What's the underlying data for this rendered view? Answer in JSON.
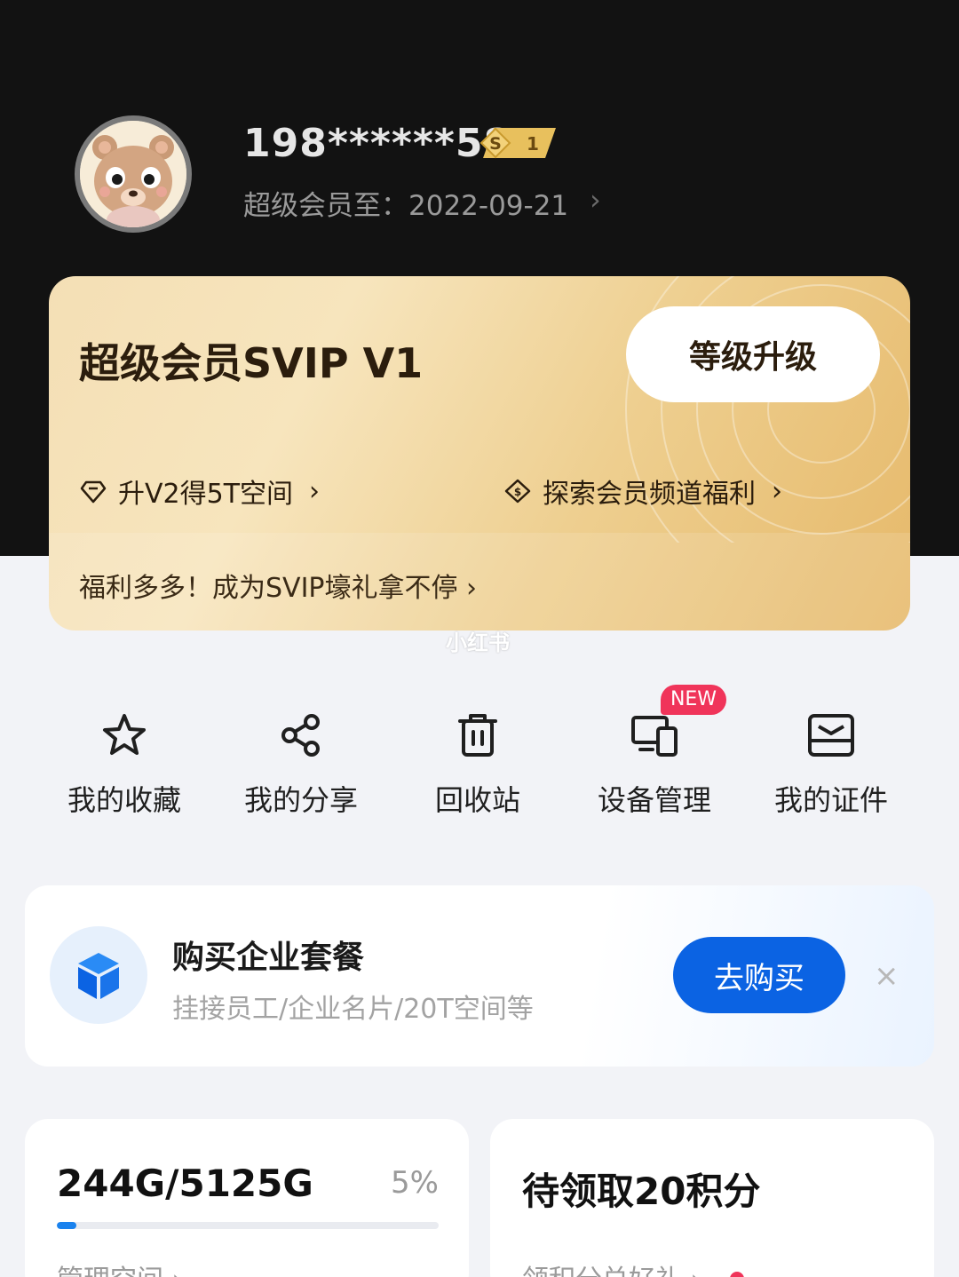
{
  "profile": {
    "username": "198******58",
    "level_badge": "1",
    "expiry": "超级会员至：2022-09-21",
    "expiry_arrow": "›"
  },
  "svip_card": {
    "title": "超级会员SVIP V1",
    "upgrade_label": "等级升级",
    "perk_upgrade": "升V2得5T空间",
    "perk_explore": "探索会员频道福利",
    "chevron": "›",
    "strip_text": "福利多多！成为SVIP壕礼拿不停 ›"
  },
  "actions": [
    {
      "label": "我的收藏",
      "icon": "star-icon"
    },
    {
      "label": "我的分享",
      "icon": "share-icon"
    },
    {
      "label": "回收站",
      "icon": "trash-icon"
    },
    {
      "label": "设备管理",
      "icon": "devices-icon"
    },
    {
      "label": "我的证件",
      "icon": "id-card-icon"
    }
  ],
  "new_badge": "NEW",
  "enterprise": {
    "title": "购买企业套餐",
    "subtitle": "挂接员工/企业名片/20T空间等",
    "buy_label": "去购买",
    "close": "×"
  },
  "storage": {
    "usage": "244G/5125G",
    "percent_label": "5%",
    "percent": 0.05,
    "manage_link": "管理空间 ›"
  },
  "points": {
    "title": "待领取20积分",
    "link": "领积分兑好礼 ›"
  },
  "watermark": "小红书",
  "colors": {
    "accent_blue": "#0b63e3",
    "progress_blue": "#1a82ee",
    "new_red": "#f0345a",
    "gold": "#eecf90"
  }
}
